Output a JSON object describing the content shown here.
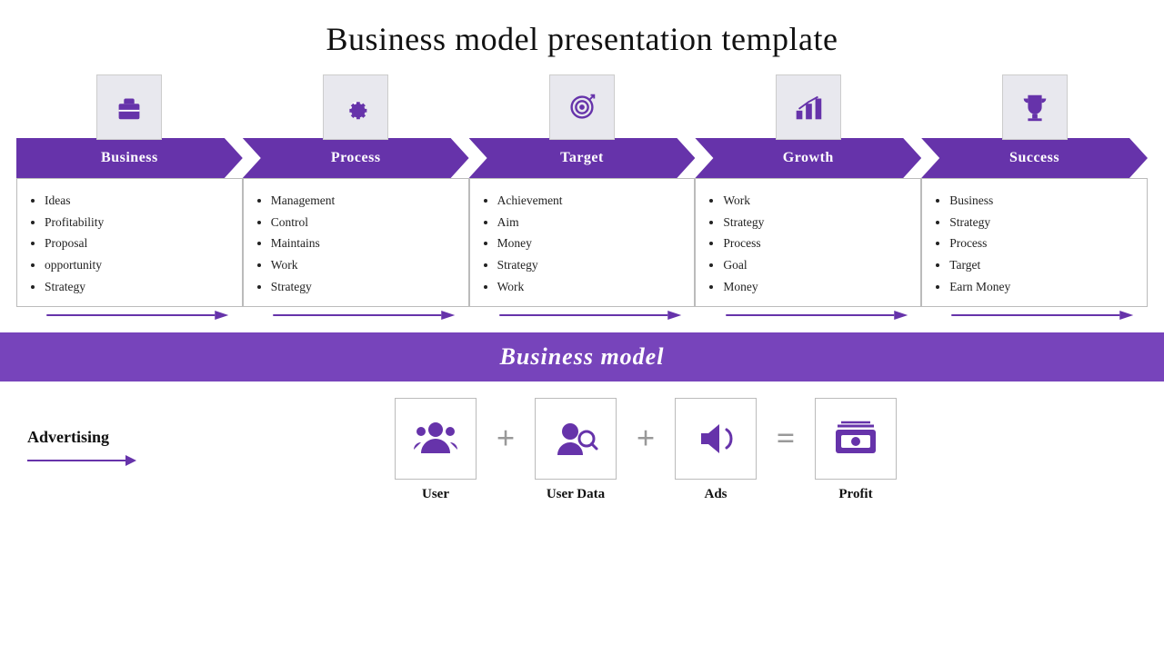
{
  "title": "Business model presentation template",
  "arrows": [
    {
      "id": "business",
      "label": "Business",
      "icon": "briefcase",
      "items": [
        "Ideas",
        "Profitability",
        "Proposal",
        "opportunity",
        "Strategy"
      ]
    },
    {
      "id": "process",
      "label": "Process",
      "icon": "gear",
      "items": [
        "Management",
        "Control",
        "Maintains",
        "Work",
        "Strategy"
      ]
    },
    {
      "id": "target",
      "label": "Target",
      "icon": "target",
      "items": [
        "Achievement",
        "Aim",
        "Money",
        "Strategy",
        "Work"
      ]
    },
    {
      "id": "growth",
      "label": "Growth",
      "icon": "chart",
      "items": [
        "Work",
        "Strategy",
        "Process",
        "Goal",
        "Money"
      ]
    },
    {
      "id": "success",
      "label": "Success",
      "icon": "trophy",
      "items": [
        "Business",
        "Strategy",
        "Process",
        "Target",
        "Earn Money"
      ]
    }
  ],
  "middle_banner": "Business model",
  "advertising_label": "Advertising",
  "bottom_items": [
    {
      "id": "user",
      "label": "User",
      "icon": "users"
    },
    {
      "id": "user-data",
      "label": "User Data",
      "icon": "search-users"
    },
    {
      "id": "ads",
      "label": "Ads",
      "icon": "megaphone"
    },
    {
      "id": "profit",
      "label": "Profit",
      "icon": "money"
    }
  ],
  "operators": [
    "+",
    "+",
    "="
  ]
}
